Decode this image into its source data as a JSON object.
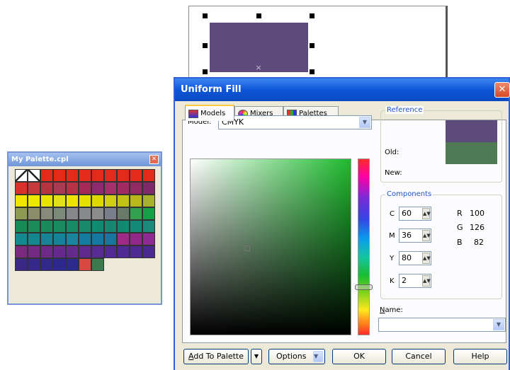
{
  "palette_window": {
    "title": "My Palette.cpl",
    "swatches": [
      "none",
      "none",
      "#e22b1b",
      "#e22b1b",
      "#e22b1b",
      "#e22b1b",
      "#e22b1b",
      "#e22b1b",
      "#e22b1b",
      "#e22b1b",
      "#e22b1b",
      "#d8322a",
      "#c53a3a",
      "#b8333f",
      "#a83a52",
      "#b83144",
      "#a52a58",
      "#8e2a6e",
      "#a8306a",
      "#a12a62",
      "#922a63",
      "#7e2a6a",
      "#f0e600",
      "#ece800",
      "#e7e500",
      "#e2e01a",
      "#ece300",
      "#e5e000",
      "#dcd800",
      "#d0ce10",
      "#c2c216",
      "#b8b81a",
      "#a6b22a",
      "#8e9a54",
      "#8b8d6a",
      "#888a7a",
      "#7c8a7a",
      "#86878a",
      "#868a8c",
      "#8a8d8c",
      "#7a7d8a",
      "#6a7a6a",
      "#32a04e",
      "#14a046",
      "#148c54",
      "#1a8c5a",
      "#1a8a5c",
      "#1a8a60",
      "#148c66",
      "#168a6a",
      "#128a72",
      "#168870",
      "#148870",
      "#128a78",
      "#1a8a7c",
      "#14888c",
      "#14868e",
      "#148496",
      "#16829a",
      "#18849e",
      "#147a9e",
      "#1478a2",
      "#1a74a0",
      "#9c2a86",
      "#92278a",
      "#8e2a92",
      "#7a2a7e",
      "#742a82",
      "#6e2a86",
      "#682a8a",
      "#642a8e",
      "#5e2a90",
      "#582a94",
      "#522a96",
      "#502a94",
      "#4e2a92",
      "#4a2a90",
      "#3a2886",
      "#362888",
      "#32288a",
      "#2e288c",
      "#2c2a8c",
      "#d8483e",
      "#3c7a4e",
      "empty",
      "empty",
      "empty",
      "empty"
    ]
  },
  "page": {
    "selection_center_mark": "×"
  },
  "dialog": {
    "title": "Uniform Fill",
    "tabs": [
      {
        "label": "Models",
        "active": true
      },
      {
        "label": "Mixers",
        "active": false
      },
      {
        "label": "Palettes",
        "active": false
      }
    ],
    "model_label": "Model:",
    "model_value": "CMYK",
    "reference": {
      "title": "Reference",
      "old_label": "Old:",
      "new_label": "New:",
      "old_color": "#5f4b7b",
      "new_color": "#4f7a53"
    },
    "components": {
      "title": "Components",
      "cmyk": [
        {
          "label": "C",
          "value": "60"
        },
        {
          "label": "M",
          "value": "36"
        },
        {
          "label": "Y",
          "value": "80"
        },
        {
          "label": "K",
          "value": "2"
        }
      ],
      "rgb": [
        {
          "label": "R",
          "value": "100"
        },
        {
          "label": "G",
          "value": "126"
        },
        {
          "label": "B",
          "value": "82"
        }
      ]
    },
    "name_label": "Name:",
    "name_value": "",
    "buttons": {
      "add_to_palette": "Add To Palette",
      "options": "Options",
      "ok": "OK",
      "cancel": "Cancel",
      "help": "Help"
    },
    "close_glyph": "✕"
  }
}
